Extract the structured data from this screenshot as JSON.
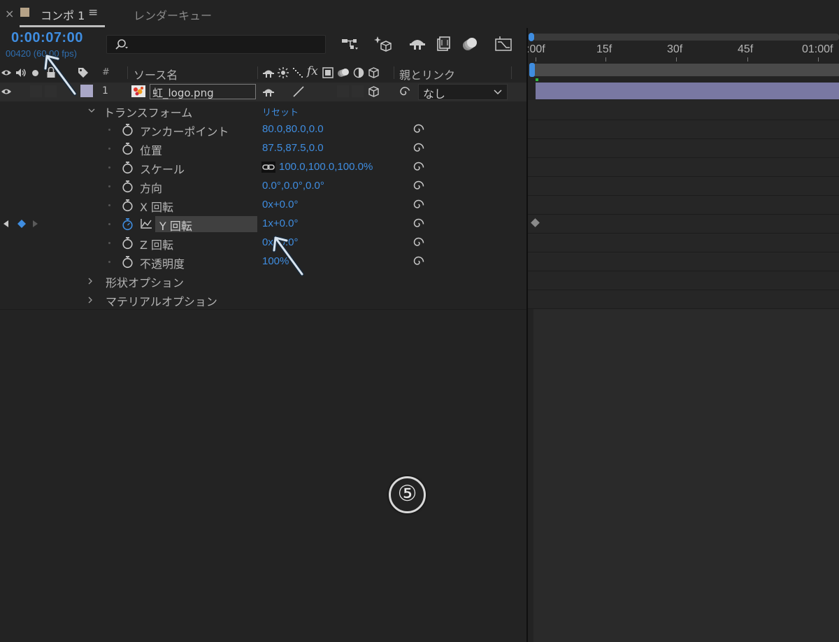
{
  "tabs": {
    "close_glyph": "×",
    "comp_label": "コンポ 1",
    "menu_glyph": "≡",
    "render_queue_label": "レンダーキュー"
  },
  "header": {
    "timecode": "0:00:07:00",
    "frames_text": "00420 (60.00 fps)",
    "search_placeholder": ""
  },
  "columns": {
    "number": "#",
    "source_name": "ソース名",
    "parent_link": "親とリンク"
  },
  "ruler": {
    "labels": [
      ":00f",
      "15f",
      "30f",
      "45f",
      "01:00f"
    ]
  },
  "layer": {
    "number": "1",
    "name": "虹_logo.png",
    "label_color": "#a9a7c7",
    "parent_value": "なし"
  },
  "groups": {
    "transform": "トランスフォーム",
    "reset": "リセット",
    "geometry": "形状オプション",
    "material": "マテリアルオプション"
  },
  "properties": [
    {
      "name": "アンカーポイント",
      "value": "80.0,80.0,0.0"
    },
    {
      "name": "位置",
      "value": "87.5,87.5,0.0"
    },
    {
      "name": "スケール",
      "value": "100.0,100.0,100.0%"
    },
    {
      "name": "方向",
      "value": "0.0°,0.0°,0.0°"
    },
    {
      "name": "X 回転",
      "value": "0x+0.0°"
    },
    {
      "name": "Y 回転",
      "value": "1x+0.0°"
    },
    {
      "name": "Z 回転",
      "value": "0x+0.0°"
    },
    {
      "name": "不透明度",
      "value": "100%"
    }
  ],
  "annotation": {
    "step_number": "⑤"
  },
  "colors": {
    "accent_blue": "#3f8de0",
    "layer_bar": "#7978a2",
    "background": "#232323"
  }
}
